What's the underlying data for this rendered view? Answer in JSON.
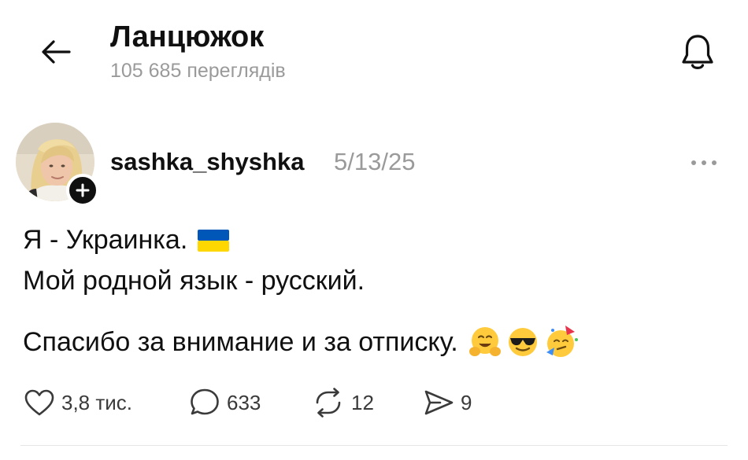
{
  "header": {
    "title": "Ланцюжок",
    "views": "105 685 переглядів",
    "back_icon": "arrow-left-icon",
    "bell_icon": "bell-icon"
  },
  "post": {
    "username": "sashka_shyshka",
    "date": "5/13/25",
    "lines": [
      "Я - Украинка.",
      "Мой родной язык - русский.",
      "Спасибо за внимание и за отписку."
    ],
    "emojis": [
      "ukraine-flag-emoji",
      "hugging-face-emoji",
      "sunglasses-face-emoji",
      "partying-face-emoji"
    ],
    "actions": {
      "likes": "3,8 тис.",
      "replies": "633",
      "reposts": "12",
      "shares": "9"
    }
  },
  "colors": {
    "text": "#101010",
    "muted": "#9a9a9a",
    "flag_blue": "#0057B7",
    "flag_yellow": "#FFD700"
  }
}
